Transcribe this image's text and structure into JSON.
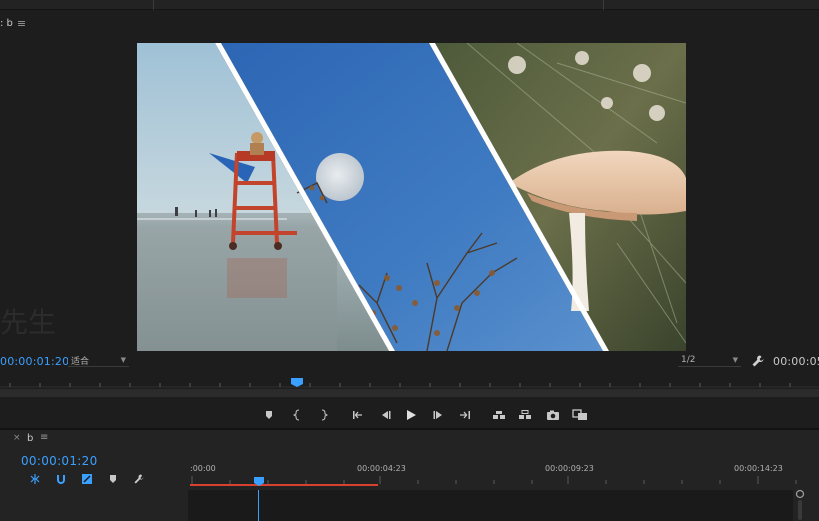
{
  "program_monitor": {
    "tab_label": ": b",
    "menu_glyph": "≡",
    "watermark": "先生",
    "playhead_timecode": "00:00:01:20",
    "zoom_select": "适合",
    "resolution_select": "1/2",
    "duration_timecode": "00:00:05",
    "settings_icon": "wrench-icon"
  },
  "transport": {
    "buttons": [
      "add-marker-icon",
      "mark-in-icon",
      "mark-out-icon",
      "go-to-in-icon",
      "step-back-icon",
      "play-icon",
      "step-forward-icon",
      "go-to-out-icon",
      "lift-icon",
      "extract-icon",
      "export-frame-icon",
      "compare-icon"
    ]
  },
  "timeline": {
    "close_glyph": "×",
    "sequence_name": "b",
    "menu_glyph": "≡",
    "timecode": "00:00:01:20",
    "tools": [
      "snap-icon",
      "linked-selection-icon",
      "add-edit-icon",
      "marker-icon",
      "settings-icon"
    ],
    "ruler_labels": [
      ":00:00",
      "00:00:04:23",
      "00:00:09:23",
      "00:00:14:23"
    ]
  },
  "colors": {
    "accent_blue": "#3aa0ff",
    "work_area_red": "#d8412f",
    "panel_bg": "#1d1d1d"
  }
}
